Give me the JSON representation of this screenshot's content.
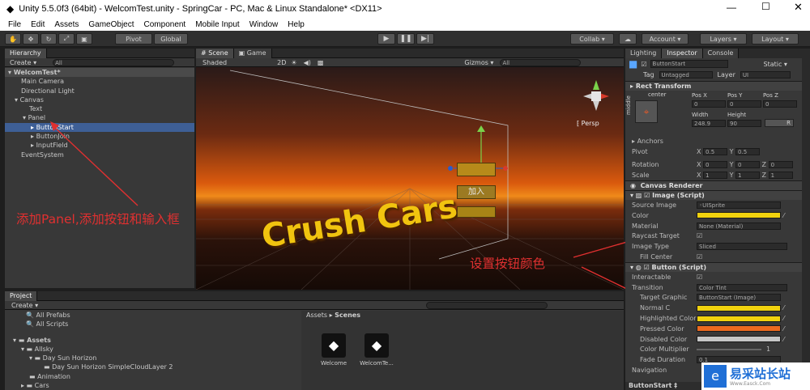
{
  "window": {
    "title": "Unity 5.5.0f3 (64bit) - WelcomTest.unity - SpringCar - PC, Mac & Linux Standalone* <DX11>"
  },
  "menu": [
    "File",
    "Edit",
    "Assets",
    "GameObject",
    "Component",
    "Mobile Input",
    "Window",
    "Help"
  ],
  "toolbar": {
    "pivot": "Pivot",
    "global": "Global",
    "collab": "Collab ▾",
    "account": "Account",
    "layers": "Layers",
    "layout": "Layout"
  },
  "hierarchy": {
    "tab": "Hierarchy",
    "create": "Create ▾",
    "search": "All",
    "scene": "WelcomTest*",
    "items": [
      "Main Camera",
      "Directional Light",
      "Canvas",
      "Text",
      "Panel",
      "ButtonStart",
      "ButtonJoin",
      "InputField",
      "EventSystem"
    ]
  },
  "scene": {
    "tab_scene": "Scene",
    "tab_game": "Game",
    "shaded": "Shaded",
    "mode2d": "2D",
    "gizmos": "Gizmos ▾",
    "search": "All",
    "persp": "Persp",
    "title": "Crush Cars",
    "btn2": "加入"
  },
  "project": {
    "tab": "Project",
    "create": "Create ▾",
    "items": [
      "All Prefabs",
      "All Scripts",
      "Assets",
      "Allsky",
      "Day Sun Horizon",
      "Day Sun Horizon SimpleCloudLayer 2",
      "Animation",
      "Cars"
    ],
    "breadcrumb_root": "Assets",
    "breadcrumb_leaf": "Scenes",
    "files": [
      "Welcome",
      "WelcomTe..."
    ]
  },
  "inspector": {
    "tabs": [
      "Lighting",
      "Inspector",
      "Console"
    ],
    "name": "ButtonStart",
    "static": "Static ▾",
    "tag_label": "Tag",
    "tag": "Untagged",
    "layer_label": "Layer",
    "layer": "UI",
    "rect_transform": "Rect Transform",
    "anchor_h": "center",
    "anchor_v": "middle",
    "posx_label": "Pos X",
    "posy_label": "Pos Y",
    "posz_label": "Pos Z",
    "posx": "0",
    "posy": "0",
    "posz": "0",
    "width_label": "Width",
    "height_label": "Height",
    "width": "248.9",
    "height": "90",
    "r": "R",
    "anchors": "Anchors",
    "pivot": "Pivot",
    "pivot_x": "0.5",
    "pivot_y": "0.5",
    "rotation": "Rotation",
    "rot_x": "0",
    "rot_y": "0",
    "rot_z": "0",
    "scale": "Scale",
    "scale_x": "1",
    "scale_y": "1",
    "scale_z": "1",
    "canvas_renderer": "Canvas Renderer",
    "image_script": "Image (Script)",
    "source_image_label": "Source Image",
    "source_image": "UISprite",
    "color_label": "Color",
    "material_label": "Material",
    "material": "None (Material)",
    "raycast": "Raycast Target",
    "image_type_label": "Image Type",
    "image_type": "Sliced",
    "fill_center": "Fill Center",
    "button_script": "Button (Script)",
    "interactable": "Interactable",
    "transition_label": "Transition",
    "transition": "Color Tint",
    "target_graphic_label": "Target Graphic",
    "target_graphic": "ButtonStart (Image)",
    "normal": "Normal C",
    "highlighted": "Highlighted Color",
    "pressed": "Pressed Color",
    "disabled": "Disabled Color",
    "multiplier_label": "Color Multiplier",
    "multiplier": "1",
    "fade_label": "Fade Duration",
    "fade": "0.1",
    "navigation": "Navigation",
    "footer_name": "ButtonStart ‡"
  },
  "annotations": {
    "left": "添加Panel,添加按钮和输入框",
    "right": "设置按钮颜色"
  },
  "watermark": {
    "text": "易采站长站",
    "sub": "Www.Easck.Com"
  },
  "colors": {
    "yellow": "#f1d20e",
    "orange": "#ec6a1f",
    "gray": "#c6c6c6",
    "accent": "#3e5f96",
    "annot": "#e03030"
  }
}
